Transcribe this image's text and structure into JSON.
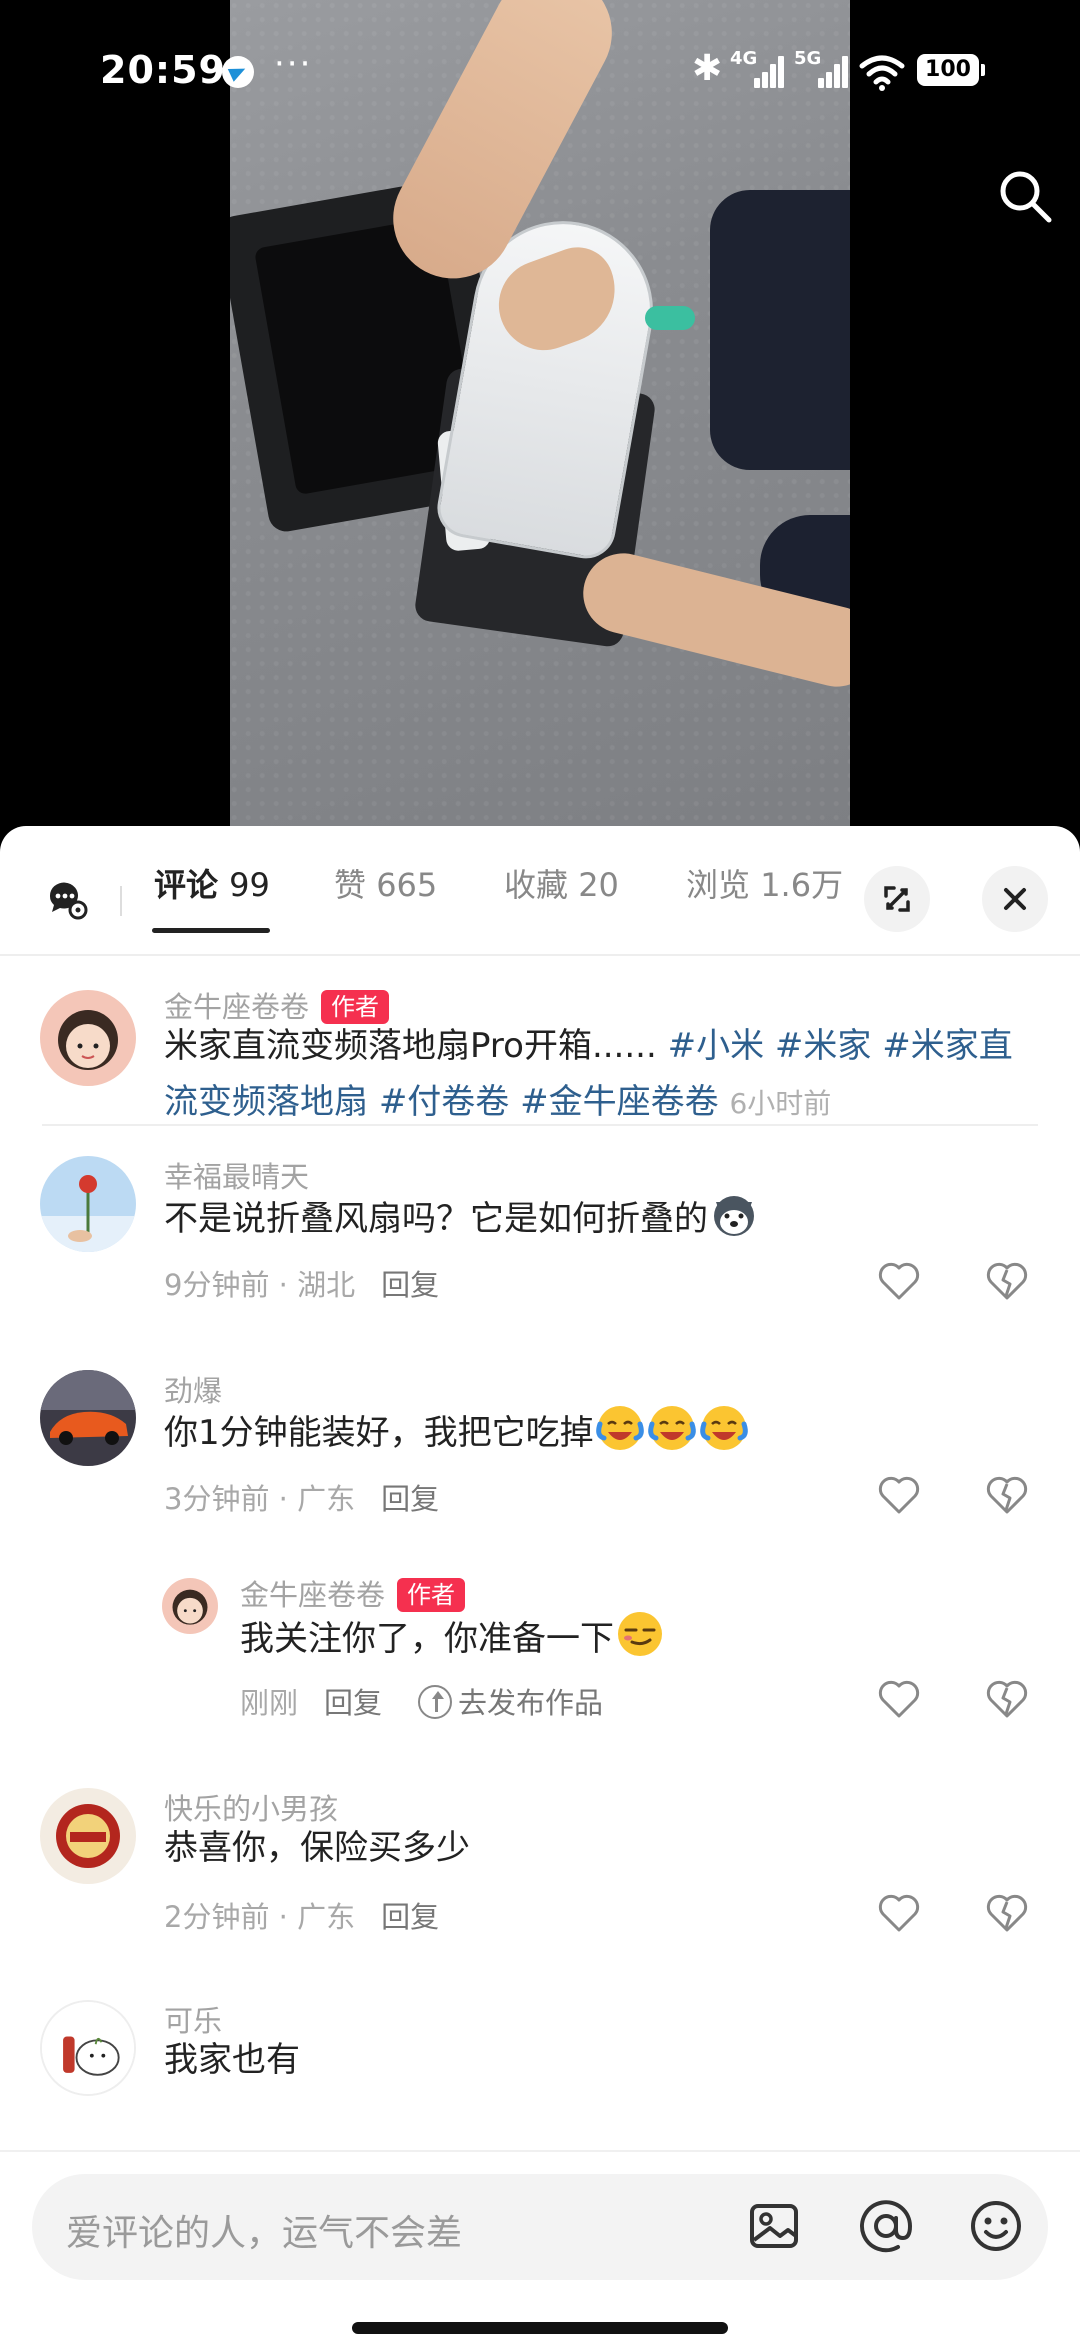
{
  "status_bar": {
    "time": "20:59",
    "dots": "···",
    "bluetooth": "✱",
    "signal_1": "4G",
    "signal_2": "5G",
    "battery": "100"
  },
  "tabs": [
    {
      "label": "评论",
      "count": "99"
    },
    {
      "label": "赞",
      "count": "665"
    },
    {
      "label": "收藏",
      "count": "20"
    },
    {
      "label": "浏览",
      "count": "1.6万"
    }
  ],
  "post": {
    "user": "金牛座卷卷",
    "badge": "作者",
    "text": "米家直流变频落地扇Pro开箱......",
    "tags": [
      "#小米",
      "#米家",
      "#米家直流变频落地扇",
      "#付卷卷",
      "#金牛座卷卷"
    ],
    "time": "6小时前"
  },
  "comments": [
    {
      "user": "幸福最晴天",
      "text": "不是说折叠风扇吗？它是如何折叠的",
      "time": "9分钟前",
      "location": "湖北",
      "reply": "回复"
    },
    {
      "user": "劲爆",
      "text": "你1分钟能装好，我把它吃掉",
      "time": "3分钟前",
      "location": "广东",
      "reply": "回复"
    },
    {
      "user": "快乐的小男孩",
      "text": "恭喜你，保险买多少",
      "time": "2分钟前",
      "location": "广东",
      "reply": "回复"
    },
    {
      "user": "可乐",
      "text": "我家也有"
    }
  ],
  "sub_reply": {
    "user": "金牛座卷卷",
    "badge": "作者",
    "text": "我关注你了，你准备一下",
    "time": "刚刚",
    "reply": "回复",
    "publish": "去发布作品"
  },
  "input": {
    "placeholder": "爱评论的人，运气不会差"
  },
  "colors": {
    "accent": "#f5304f",
    "tag": "#2e5f8e"
  },
  "icons": [
    "search-icon",
    "chat-settings-icon",
    "expand-icon",
    "close-icon",
    "heart-icon",
    "broken-heart-icon",
    "image-icon",
    "at-icon",
    "emoji-icon"
  ]
}
